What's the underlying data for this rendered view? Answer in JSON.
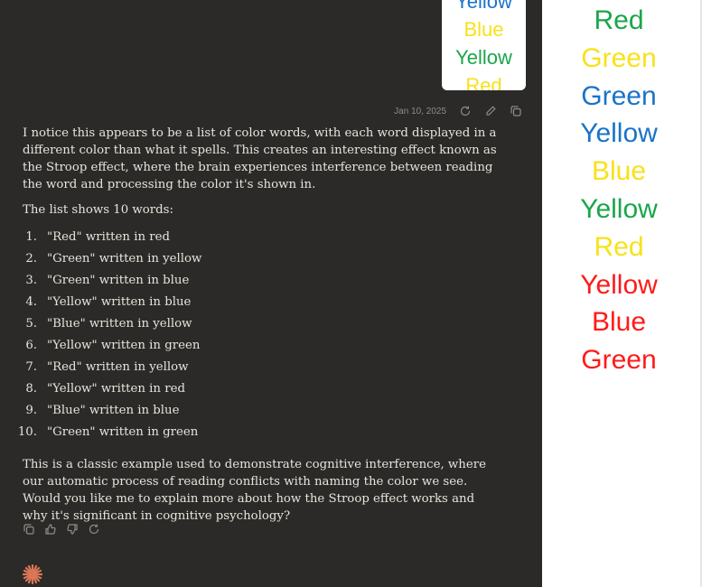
{
  "thumbnail": {
    "words": [
      {
        "text": "Yellow",
        "color": "#1a73c7"
      },
      {
        "text": "Blue",
        "color": "#f7e21a"
      },
      {
        "text": "Yellow",
        "color": "#1aa64a"
      },
      {
        "text": "Red",
        "color": "#f7e21a"
      }
    ]
  },
  "message_meta": {
    "timestamp": "Jan 10, 2025",
    "icons": [
      "retry-icon",
      "edit-icon",
      "copy-icon"
    ]
  },
  "response": {
    "intro": "I notice this appears to be a list of color words, with each word displayed in a different color than what it spells. This creates an interesting effect known as the Stroop effect, where the brain experiences interference between reading the word and processing the color it's shown in.",
    "list_heading": "The list shows 10 words:",
    "items": [
      {
        "num": "1.",
        "text": "\"Red\" written in red"
      },
      {
        "num": "2.",
        "text": "\"Green\" written in yellow"
      },
      {
        "num": "3.",
        "text": "\"Green\" written in blue"
      },
      {
        "num": "4.",
        "text": "\"Yellow\" written in blue"
      },
      {
        "num": "5.",
        "text": "\"Blue\" written in yellow"
      },
      {
        "num": "6.",
        "text": "\"Yellow\" written in green"
      },
      {
        "num": "7.",
        "text": "\"Red\" written in yellow"
      },
      {
        "num": "8.",
        "text": "\"Yellow\" written in red"
      },
      {
        "num": "9.",
        "text": "\"Blue\" written in blue"
      },
      {
        "num": "10.",
        "text": "\"Green\" written in green"
      }
    ],
    "outro": "This is a classic example used to demonstrate cognitive interference, where our automatic process of reading conflicts with naming the color we see. Would you like me to explain more about how the Stroop effect works and why it's significant in cognitive psychology?"
  },
  "actions": [
    "copy-icon",
    "thumbs-up-icon",
    "thumbs-down-icon",
    "retry-icon"
  ],
  "colors": {
    "chat_bg": "#2b2a28",
    "text": "#e8e4dc",
    "muted": "#8f8c86",
    "brand": "#d97757"
  },
  "panel": {
    "words": [
      {
        "text": "Red",
        "color": "#1aa64a"
      },
      {
        "text": "Green",
        "color": "#f7e21a"
      },
      {
        "text": "Green",
        "color": "#1a73c7"
      },
      {
        "text": "Yellow",
        "color": "#1a73c7"
      },
      {
        "text": "Blue",
        "color": "#f7e21a"
      },
      {
        "text": "Yellow",
        "color": "#1aa64a"
      },
      {
        "text": "Red",
        "color": "#f7e21a"
      },
      {
        "text": "Yellow",
        "color": "#ff1a1a"
      },
      {
        "text": "Blue",
        "color": "#ff1a1a"
      },
      {
        "text": "Green",
        "color": "#ff1a1a"
      }
    ]
  }
}
